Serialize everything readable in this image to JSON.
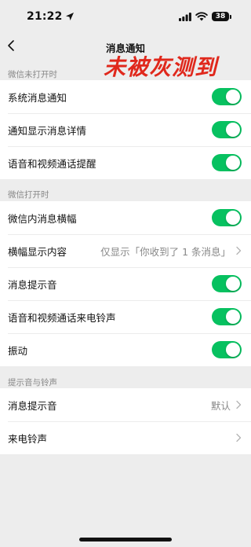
{
  "status_bar": {
    "time": "21:22",
    "battery": "38"
  },
  "nav": {
    "title": "消息通知",
    "back_icon": "chevron-left-icon"
  },
  "watermark": "未被灰测到",
  "sections": [
    {
      "header": "微信未打开时",
      "rows": [
        {
          "label": "系统消息通知",
          "toggle": true
        },
        {
          "label": "通知显示消息详情",
          "toggle": true
        },
        {
          "label": "语音和视频通话提醒",
          "toggle": true
        }
      ]
    },
    {
      "header": "微信打开时",
      "rows": [
        {
          "label": "微信内消息横幅",
          "toggle": true
        },
        {
          "label": "横幅显示内容",
          "value": "仅显示「你收到了 1 条消息」"
        },
        {
          "label": "消息提示音",
          "toggle": true
        },
        {
          "label": "语音和视频通话来电铃声",
          "toggle": true
        },
        {
          "label": "振动",
          "toggle": true
        }
      ]
    },
    {
      "header": "提示音与铃声",
      "rows": [
        {
          "label": "消息提示音",
          "value": "默认"
        },
        {
          "label": "来电铃声",
          "value": ""
        }
      ]
    }
  ],
  "colors": {
    "toggle_on": "#07c160",
    "watermark": "#e0281c",
    "background": "#ededed"
  }
}
